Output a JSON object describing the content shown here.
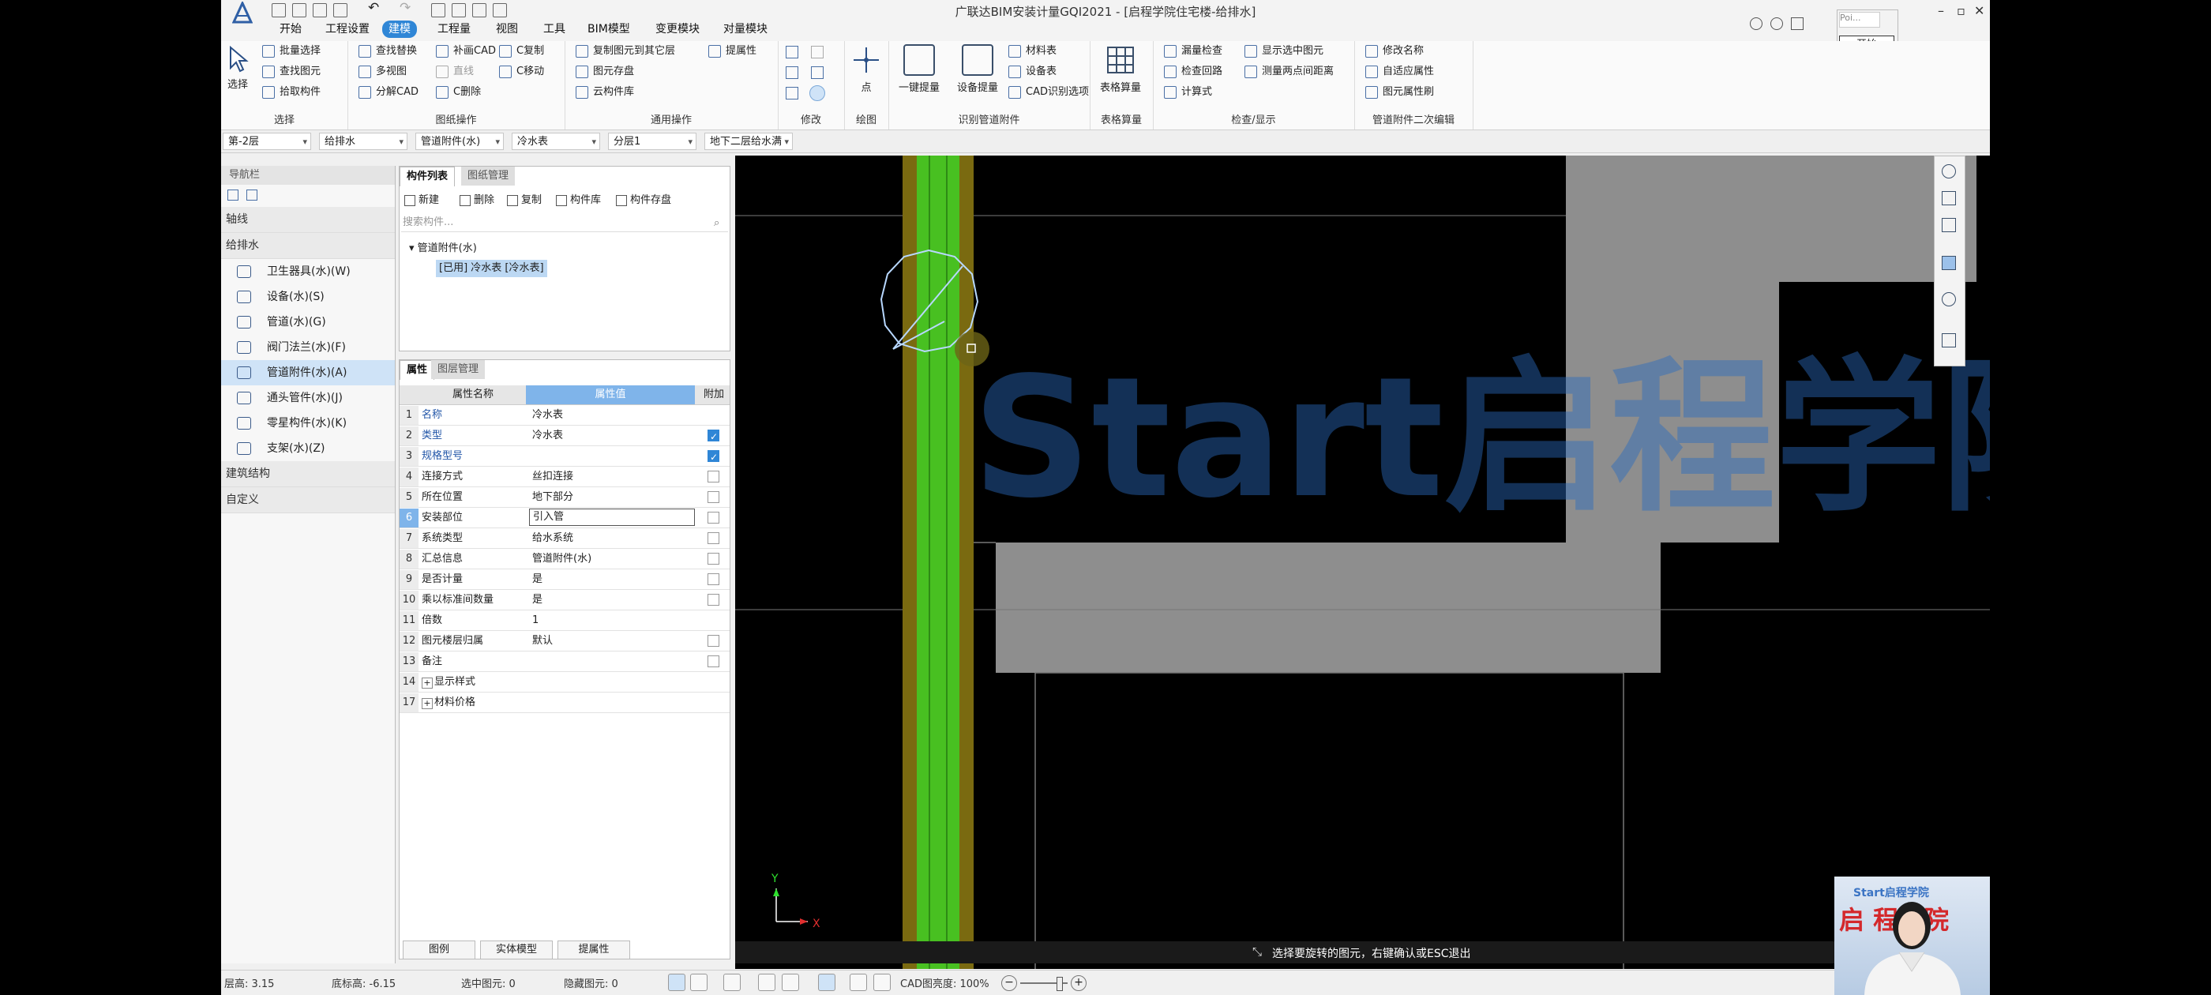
{
  "window": {
    "title": "广联达BIM安装计量GQI2021 - [启程学院住宅楼-给排水]"
  },
  "menu": [
    "开始",
    "工程设置",
    "建模",
    "工程量",
    "视图",
    "工具",
    "BIM模型",
    "变更模块",
    "对量模块"
  ],
  "active_menu": "建模",
  "popup": {
    "input_text": "Poi...",
    "button": "开始"
  },
  "ribbon": {
    "select": {
      "big": "选择",
      "items": [
        "批量选择",
        "查找图元",
        "拾取构件"
      ],
      "label": "选择"
    },
    "drawing_ops": {
      "items": [
        "查找替换",
        "多视图",
        "分解CAD",
        "补画CAD",
        "直线",
        "C删除",
        "C复制",
        "C移动"
      ],
      "label": "图纸操作"
    },
    "common_ops": {
      "items": [
        "复制图元到其它层",
        "图元存盘",
        "云构件库",
        "提属性"
      ],
      "label": "通用操作"
    },
    "modify": {
      "label": "修改"
    },
    "draw": {
      "big": "点",
      "label": "绘图"
    },
    "identify": {
      "big": [
        "一键提量",
        "设备提量"
      ],
      "items": [
        "材料表",
        "设备表",
        "CAD识别选项"
      ],
      "label": "识别管道附件"
    },
    "table_calc": {
      "big": "表格算量",
      "label": "表格算量"
    },
    "check": {
      "items": [
        "漏量检查",
        "检查回路",
        "计算式",
        "显示选中图元",
        "测量两点间距离"
      ],
      "label": "检查/显示"
    },
    "secondary_edit": {
      "items": [
        "修改名称",
        "自适应属性",
        "图元属性刷"
      ],
      "label": "管道附件二次编辑"
    }
  },
  "selectors": [
    "第-2层",
    "给排水",
    "管道附件(水)",
    "冷水表",
    "分层1",
    "地下二层给水满"
  ],
  "nav": {
    "title": "导航栏",
    "categories": [
      "轴线",
      "给排水",
      "建筑结构",
      "自定义"
    ],
    "items": [
      "卫生器具(水)(W)",
      "设备(水)(S)",
      "管道(水)(G)",
      "阀门法兰(水)(F)",
      "管道附件(水)(A)",
      "通头管件(水)(J)",
      "零星构件(水)(K)",
      "支架(水)(Z)"
    ],
    "selected": "管道附件(水)(A)"
  },
  "component_list": {
    "tabs": [
      "构件列表",
      "图纸管理"
    ],
    "tools": [
      "新建",
      "删除",
      "复制",
      "构件库",
      "构件存盘"
    ],
    "search_placeholder": "搜索构件...",
    "tree_root": "管道附件(水)",
    "tree_child": "[已用] 冷水表 [冷水表]"
  },
  "properties": {
    "tabs": [
      "属性",
      "图层管理"
    ],
    "headers": [
      "属性名称",
      "属性值",
      "附加"
    ],
    "rows": [
      {
        "n": "1",
        "name": "名称",
        "value": "冷水表"
      },
      {
        "n": "2",
        "name": "类型",
        "value": "冷水表"
      },
      {
        "n": "3",
        "name": "规格型号",
        "value": ""
      },
      {
        "n": "4",
        "name": "连接方式",
        "value": "丝扣连接"
      },
      {
        "n": "5",
        "name": "所在位置",
        "value": "地下部分"
      },
      {
        "n": "6",
        "name": "安装部位",
        "value": "引入管"
      },
      {
        "n": "7",
        "name": "系统类型",
        "value": "给水系统"
      },
      {
        "n": "8",
        "name": "汇总信息",
        "value": "管道附件(水)"
      },
      {
        "n": "9",
        "name": "是否计量",
        "value": "是"
      },
      {
        "n": "10",
        "name": "乘以标准间数量",
        "value": "是"
      },
      {
        "n": "11",
        "name": "倍数",
        "value": "1"
      },
      {
        "n": "12",
        "name": "图元楼层归属",
        "value": "默认"
      },
      {
        "n": "13",
        "name": "备注",
        "value": ""
      },
      {
        "n": "14",
        "name": "显示样式",
        "value": ""
      },
      {
        "n": "17",
        "name": "材料价格",
        "value": ""
      }
    ],
    "bottom_buttons": [
      "图例",
      "实体模型",
      "提属性"
    ]
  },
  "canvas": {
    "watermark": "Start启程学院",
    "status_hint": "选择要旋转的图元，右键确认或ESC退出",
    "axis_x": "X",
    "axis_y": "Y"
  },
  "statusbar": {
    "floor_height": "层高: 3.15",
    "bottom_height": "底标高: -6.15",
    "selected": "选中图元: 0",
    "hidden": "隐藏图元: 0",
    "cad_brightness": "CAD图亮度: 100%"
  },
  "webcam": {
    "logo": "Start启程学院",
    "banner": "启 程学院"
  }
}
